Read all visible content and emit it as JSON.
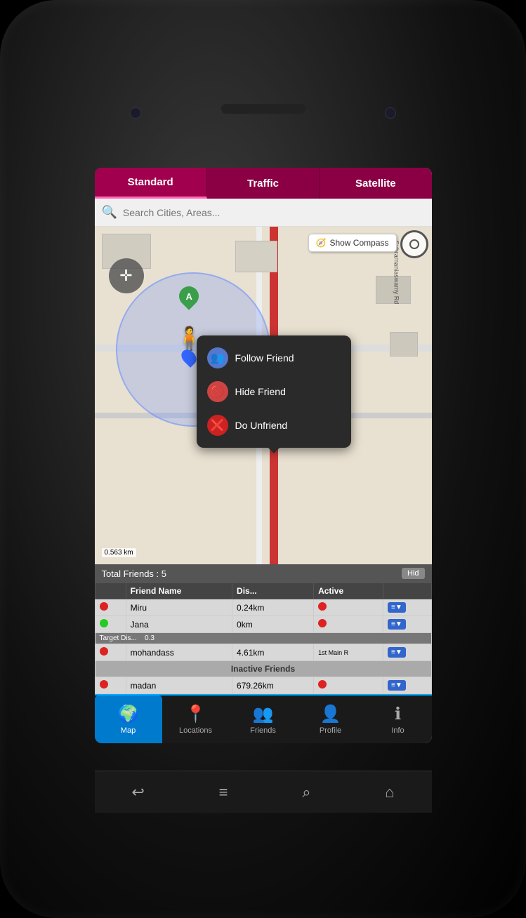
{
  "phone": {
    "nav_buttons": [
      "↩",
      "≡",
      "⌕",
      "⌂"
    ]
  },
  "map_tabs": {
    "items": [
      {
        "label": "Standard",
        "active": true
      },
      {
        "label": "Traffic",
        "active": false
      },
      {
        "label": "Satellite",
        "active": false
      }
    ]
  },
  "search": {
    "placeholder": "Search Cities, Areas...",
    "value": ""
  },
  "map": {
    "compass_btn": "Show Compass",
    "road_label": "Subramaniaswamy Rd",
    "distance": "0.563 km",
    "circle_label": "A"
  },
  "context_menu": {
    "items": [
      {
        "label": "Follow Friend",
        "icon": "👥",
        "type": "follow"
      },
      {
        "label": "Hide Friend",
        "icon": "🚫",
        "type": "hide"
      },
      {
        "label": "Do Unfriend",
        "icon": "❌",
        "type": "unfriend"
      }
    ]
  },
  "friends_panel": {
    "header": "Total Friends : 5",
    "hide_btn": "Hid",
    "target_dist": "Target Dis...",
    "dist_val": "0.3",
    "columns": {
      "name": "Friend Name",
      "dist": "Dis...",
      "active": "Active"
    },
    "active_friends": [
      {
        "name": "Miru",
        "dist": "0.24km",
        "status": "red"
      },
      {
        "name": "Jana",
        "dist": "0km",
        "status": "green"
      },
      {
        "name": "mohandass",
        "dist": "4.61km",
        "extra": "1st Main R",
        "status": "red"
      }
    ],
    "inactive_section": "Inactive Friends",
    "inactive_friends": [
      {
        "name": "madan",
        "dist": "679.26km",
        "status": "red"
      }
    ]
  },
  "bottom_tabs": [
    {
      "label": "Map",
      "icon": "🌍",
      "active": true
    },
    {
      "label": "Locations",
      "icon": "📍",
      "active": false
    },
    {
      "label": "Friends",
      "icon": "👥",
      "active": false
    },
    {
      "label": "Profile",
      "icon": "👤",
      "active": false
    },
    {
      "label": "Info",
      "icon": "ℹ",
      "active": false
    }
  ]
}
